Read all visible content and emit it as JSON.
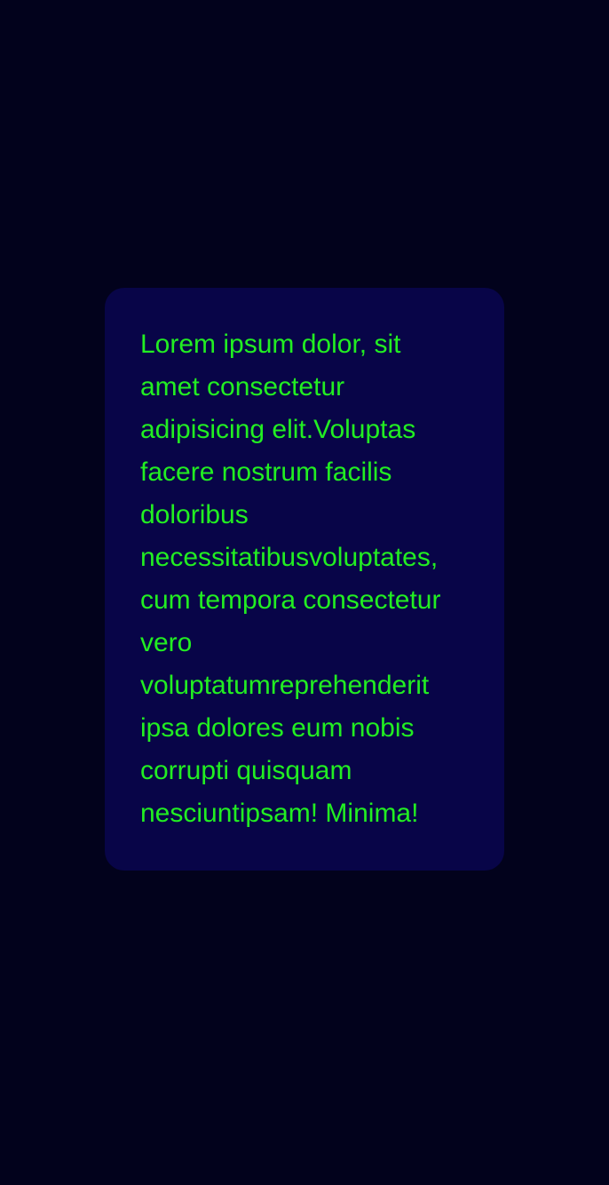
{
  "card": {
    "lines": [
      "Lorem ipsum dolor, sit",
      "amet consectetur",
      "adipisicing elit.Voluptas",
      "facere nostrum facilis",
      "doloribus",
      "necessitatibusvoluptates,",
      "cum tempora consectetur",
      "vero",
      "voluptatumreprehenderit",
      "ipsa dolores eum nobis",
      "corrupti quisquam",
      "nesciuntipsam! Minima!"
    ]
  },
  "colors": {
    "background": "#02021c",
    "card": "#080548",
    "text": "#22ee22"
  }
}
